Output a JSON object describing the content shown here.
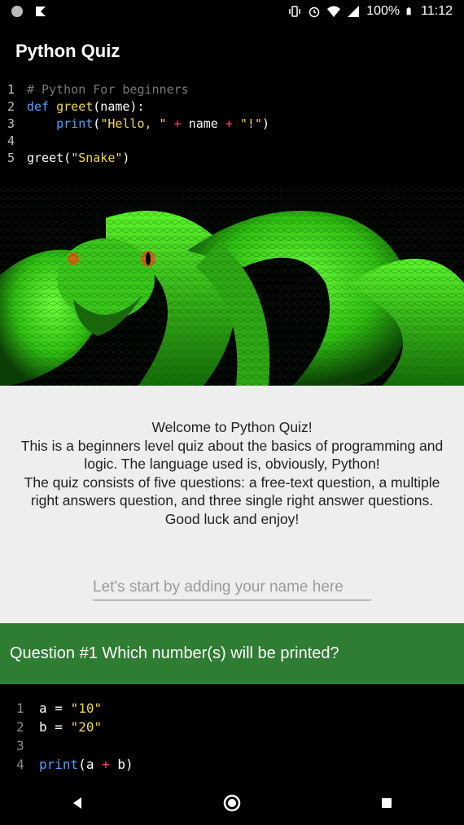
{
  "status_bar": {
    "battery": "100%",
    "time": "11:12"
  },
  "app": {
    "title": "Python Quiz"
  },
  "header_code": {
    "lines": [
      {
        "n": "1",
        "comment": "# Python For beginners"
      },
      {
        "n": "2",
        "kw": "def",
        "fn": "greet",
        "rest": "(name):"
      },
      {
        "n": "3",
        "bi": "print",
        "open": "(",
        "str1": "\"Hello, \"",
        "op1": "+",
        "id": "name",
        "op2": "+",
        "str2": "\"!\"",
        "close": ")"
      },
      {
        "n": "4"
      },
      {
        "n": "5",
        "fn": "greet",
        "open": "(",
        "str": "\"Snake\"",
        "close": ")"
      }
    ]
  },
  "welcome": {
    "lines": [
      "Welcome to Python Quiz!",
      "This is a beginners level quiz about the basics of programming and logic. The language used is, obviously, Python!",
      "The quiz consists of five questions: a free-text question, a multiple right answers question, and three single right answer questions.",
      "Good luck and enjoy!"
    ],
    "name_placeholder": "Let's start by adding your name here"
  },
  "question": {
    "title": "Question #1 Which number(s) will be printed?"
  },
  "question_code": {
    "lines": [
      {
        "n": "1",
        "var": "a",
        "eq": "=",
        "str": "\"10\""
      },
      {
        "n": "2",
        "var": "b",
        "eq": "=",
        "str": "\"20\""
      },
      {
        "n": "3"
      },
      {
        "n": "4",
        "bi": "print",
        "open": "(",
        "a": "a",
        "op": "+",
        "b": "b",
        "close": ")"
      }
    ]
  },
  "colors": {
    "accent": "#2e7d32",
    "panel": "#eeeeee"
  }
}
